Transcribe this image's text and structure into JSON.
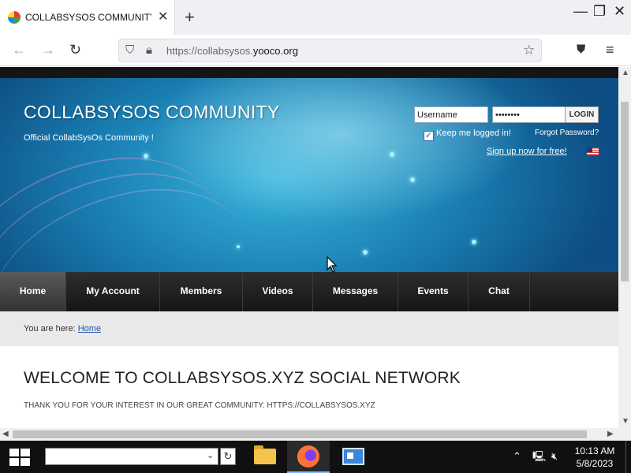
{
  "browser": {
    "tab_title": "COLLABSYSOS COMMUNITY -",
    "tab_close": "✕",
    "new_tab": "+",
    "url_prefix": "https://collabsysos.",
    "url_domain": "yooco.org",
    "window_controls": [
      "—",
      "❐",
      "✕"
    ]
  },
  "header": {
    "site_title": "COLLABSYSOS COMMUNITY",
    "subtitle": "Official CollabSysOs Community !",
    "username_value": "Username",
    "password_value": "••••••••",
    "login_label": "LOGIN",
    "keep_logged_in": "Keep me logged in!",
    "forgot_password": "Forgot Password?",
    "signup": "Sign up now for free!"
  },
  "menu": {
    "items": [
      "Home",
      "My Account",
      "Members",
      "Videos",
      "Messages",
      "Events",
      "Chat"
    ],
    "active": "Home"
  },
  "breadcrumb": {
    "prefix": "You are here:",
    "link": "Home"
  },
  "content": {
    "heading": "WELCOME TO COLLABSYSOS.XYZ SOCIAL NETWORK",
    "text": "THANK YOU FOR YOUR INTEREST IN OUR GREAT COMMUNITY. HTTPS://COLLABSYSOS.XYZ"
  },
  "taskbar": {
    "search_value": "",
    "time": "10:13 AM",
    "date": "5/8/2023"
  },
  "colors": {
    "header_blue": "#1a7fb3",
    "menu_dark": "#1e1e1e",
    "link_blue": "#2255aa"
  }
}
